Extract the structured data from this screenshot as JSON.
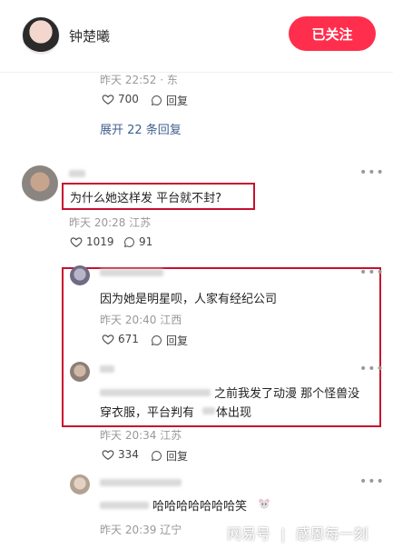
{
  "header": {
    "author_name": "钟楚曦",
    "follow_label": "已关注"
  },
  "top_reply": {
    "meta": "昨天 22:52 · 东",
    "likes": "700",
    "reply_label": "回复",
    "expand_label": "展开 22 条回复"
  },
  "comment": {
    "text": "为什么她这样发 平台就不封?",
    "meta": "昨天 20:28 江苏",
    "likes": "1019",
    "replies": "91"
  },
  "reply1": {
    "text": "因为她是明星呗，人家有经纪公司",
    "meta": "昨天 20:40 江西",
    "likes": "671",
    "reply_label": "回复"
  },
  "reply2": {
    "text_line1": "之前我发了动漫 那个怪兽没",
    "text_line2_a": "穿衣服，平台判有",
    "text_line2_b": "体出现",
    "meta": "昨天 20:34 江苏",
    "likes": "334",
    "reply_label": "回复"
  },
  "reply3": {
    "text": "哈哈哈哈哈哈哈笑",
    "meta": "昨天 20:39 辽宁"
  },
  "watermark": {
    "brand": "网易号",
    "separator": "|",
    "account": "感恩每一刻"
  },
  "icons": {
    "like": "heart-outline-icon",
    "reply": "speech-bubble-icon",
    "more": "more-dots-icon"
  },
  "colors": {
    "accent": "#ff2e4d",
    "highlight_box": "#c8102e",
    "link": "#41608f"
  }
}
